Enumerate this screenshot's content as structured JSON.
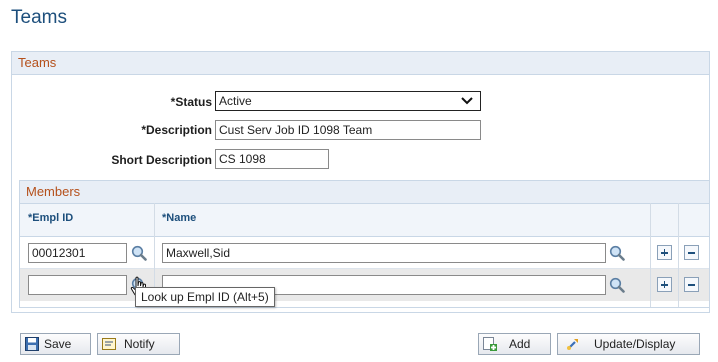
{
  "page": {
    "title": "Teams"
  },
  "teams_section": {
    "header": "Teams",
    "status": {
      "label": "*Status",
      "value": "Active"
    },
    "description": {
      "label": "*Description",
      "value": "Cust Serv Job ID 1098 Team"
    },
    "short_description": {
      "label": "Short Description",
      "value": "CS 1098"
    }
  },
  "members": {
    "header": "Members",
    "columns": {
      "empl_id": "*Empl ID",
      "name": "*Name"
    },
    "rows": [
      {
        "empl_id": "00012301",
        "name": "Maxwell,Sid"
      },
      {
        "empl_id": "",
        "name": ""
      }
    ]
  },
  "tooltip": "Look up Empl ID (Alt+5)",
  "toolbar": {
    "save": "Save",
    "notify": "Notify",
    "add": "Add",
    "update_display": "Update/Display"
  },
  "colors": {
    "title": "#1d4f7c",
    "section_header": "#b5501b",
    "header_bg": "#e8eef6"
  }
}
